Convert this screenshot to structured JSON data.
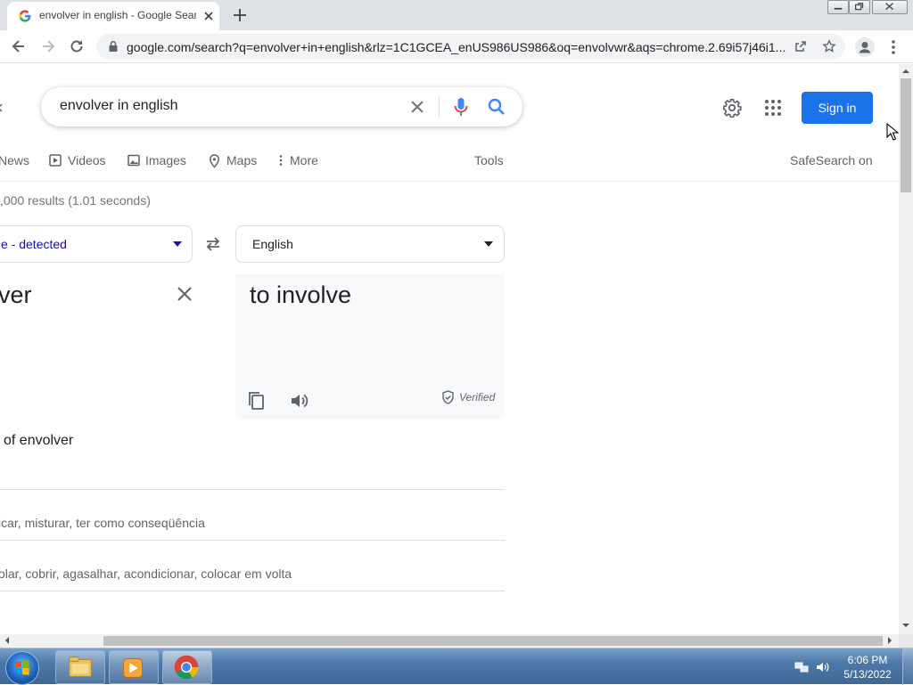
{
  "browser": {
    "tab_title": "envolver in english - Google Search",
    "url": "google.com/search?q=envolver+in+english&rlz=1C1GCEA_enUS986US986&oq=envolvwr&aqs=chrome.2.69i57j46i1..."
  },
  "search": {
    "query": "envolver in english",
    "sign_in": "Sign in"
  },
  "nav": {
    "news": "News",
    "videos": "Videos",
    "images": "Images",
    "maps": "Maps",
    "more": "More",
    "tools": "Tools",
    "safesearch": "SafeSearch on"
  },
  "results": {
    "stats": ",000 results (1.01 seconds)"
  },
  "translate": {
    "source_lang": "e - detected",
    "target_lang": "English",
    "source_text": "ver",
    "target_text": "to involve",
    "verified": "Verified",
    "definitions_title": " of envolver",
    "def_lines": [
      "icar, misturar, ter como conseqüência",
      "olar, cobrir, agasalhar, acondicionar, colocar em volta"
    ]
  },
  "taskbar": {
    "time": "6:06 PM",
    "date": "5/13/2022"
  },
  "colors": {
    "accent": "#1a73e8",
    "mic_blue": "#4285f4",
    "mic_red": "#ea4335"
  }
}
